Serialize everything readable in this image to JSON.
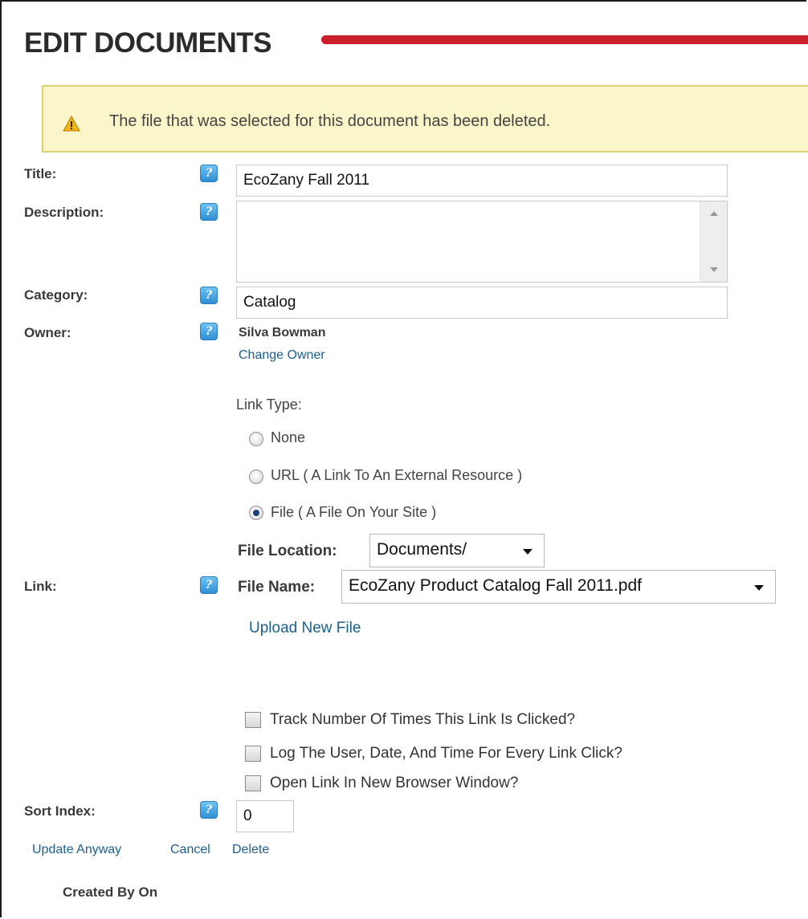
{
  "header": {
    "title": "EDIT DOCUMENTS"
  },
  "alert": {
    "message": "The file that was selected for this document has been deleted.",
    "icon": "warning-icon"
  },
  "help_icon_glyph": "?",
  "form": {
    "title_label": "Title:",
    "title_value": "EcoZany Fall 2011",
    "description_label": "Description:",
    "description_value": "",
    "category_label": "Category:",
    "category_value": "Catalog",
    "owner_label": "Owner:",
    "owner_name": "Silva Bowman",
    "change_owner": "Change Owner",
    "link_type_label": "Link Type:",
    "link_types": [
      {
        "label": "None",
        "checked": false
      },
      {
        "label": "URL ( A Link To An External Resource )",
        "checked": false
      },
      {
        "label": "File ( A File On Your Site )",
        "checked": true
      }
    ],
    "file_location_label": "File Location:",
    "file_location_value": "Documents/",
    "link_label": "Link:",
    "file_name_label": "File Name:",
    "file_name_value": "EcoZany Product Catalog Fall 2011.pdf",
    "upload_link": "Upload New File",
    "options": [
      {
        "label": "Track Number Of Times This Link Is Clicked?",
        "checked": false
      },
      {
        "label": "Log The User, Date, And Time For Every Link Click?",
        "checked": false
      },
      {
        "label": "Open Link In New Browser Window?",
        "checked": false
      }
    ],
    "sort_index_label": "Sort Index:",
    "sort_index_value": "0"
  },
  "actions": {
    "update": "Update Anyway",
    "cancel": "Cancel",
    "delete": "Delete"
  },
  "footer": {
    "created_by": "Created By On"
  },
  "colors": {
    "accent_red": "#cc1f2c",
    "link_blue": "#1d5e8c",
    "warning_bg": "#fbf6c9",
    "warning_border": "#dcd370"
  }
}
